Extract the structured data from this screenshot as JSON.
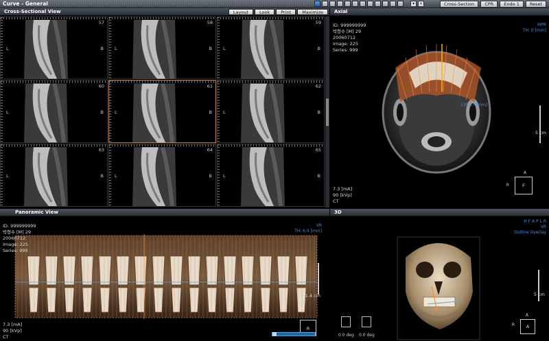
{
  "titlebar": {
    "title": "Curve - General",
    "mode_buttons": [
      "Cross-Section",
      "CPR",
      "Endo 1",
      "Reset"
    ]
  },
  "cross_section": {
    "title": "Cross-Sectional View",
    "tools": [
      "Layout",
      "Look",
      "Print",
      "Maximize"
    ],
    "cells": [
      {
        "num": "57",
        "L": "L",
        "B": "B"
      },
      {
        "num": "58",
        "L": "L",
        "B": "B"
      },
      {
        "num": "59",
        "L": "L",
        "B": "B"
      },
      {
        "num": "60",
        "L": "L",
        "B": "B"
      },
      {
        "num": "61",
        "L": "L",
        "B": "B"
      },
      {
        "num": "62",
        "L": "L",
        "B": "B"
      },
      {
        "num": "63",
        "L": "L",
        "B": "B"
      },
      {
        "num": "64",
        "L": "L",
        "B": "B"
      },
      {
        "num": "65",
        "L": "L",
        "B": "B"
      }
    ],
    "selected_index": 4
  },
  "axial": {
    "title": "Axial",
    "id": "ID: 999999999",
    "patient": "박형수 [M] 29",
    "date": "20060712",
    "image": "Image: 225",
    "series": "Series: 999",
    "mode": "MPR",
    "thickness": "TH: 0 [mm]",
    "measure": "135.57 [mm]",
    "scale": "5 cm",
    "orient_top": "A",
    "orient_left": "R",
    "orient_center": "F",
    "ma": "7.3 [mA]",
    "kvp": "90 [kVp]",
    "modality": "CT"
  },
  "panoramic": {
    "title": "Panoramic View",
    "id": "ID: 999999999",
    "patient": "박형수 [M] 29",
    "date": "20060712",
    "image": "Image: 225",
    "series": "Series: 999",
    "mode": "VR",
    "thickness": "TH: 6.9 [mm]",
    "scale": "1.4 cm",
    "orient_center": "R",
    "ma": "7.3 [mA]",
    "kvp": "90 [kVp]",
    "modality": "CT"
  },
  "view3d": {
    "title": "3D",
    "orient": "H F A P L R",
    "mode": "VR",
    "overlay": "Outline Overlay",
    "scale": "5 cm",
    "orient_top": "A",
    "orient_left": "R",
    "orient_center": "A",
    "deg1": "0.0 deg",
    "deg2": "0.0 deg"
  }
}
